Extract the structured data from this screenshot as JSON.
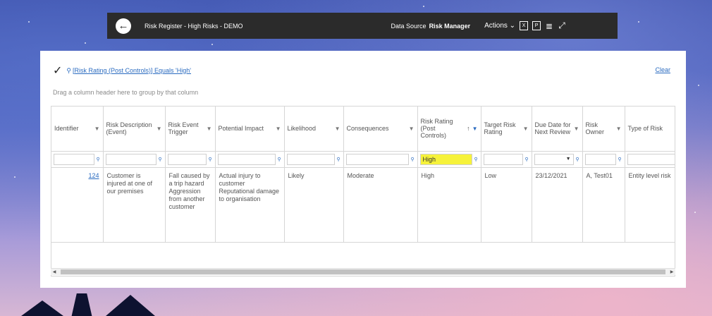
{
  "topbar": {
    "title": "Risk Register - High Risks - DEMO",
    "data_source_label": "Data Source",
    "data_source_value": "Risk Manager",
    "actions_label": "Actions ⌄",
    "icons": [
      "back-icon",
      "excel-export-icon",
      "pdf-export-icon",
      "list-icon",
      "expand-icon"
    ]
  },
  "filter": {
    "checkmark": "✓",
    "filter_icon": "⚲",
    "expression": "[Risk Rating (Post Controls)] Equals 'High'",
    "clear_label": "Clear"
  },
  "group_hint": "Drag a column header here to group by that column",
  "table": {
    "columns": [
      {
        "label": "Identifier"
      },
      {
        "label": "Risk Description (Event)"
      },
      {
        "label": "Risk Event Trigger"
      },
      {
        "label": "Potential Impact"
      },
      {
        "label": "Likelihood"
      },
      {
        "label": "Consequences"
      },
      {
        "label": "Risk Rating (Post Controls)"
      },
      {
        "label": "Target Risk Rating"
      },
      {
        "label": "Due Date for Next Review"
      },
      {
        "label": "Risk Owner"
      },
      {
        "label": "Type of Risk"
      }
    ],
    "filters": [
      "",
      "",
      "",
      "",
      "",
      "",
      "High",
      "",
      "",
      "",
      ""
    ],
    "rows": [
      {
        "identifier": "124",
        "risk_description": "Customer is injured at one of our premises",
        "event_trigger": "Fall caused by a trip hazard Aggression from another customer",
        "potential_impact": "Actual injury to customer Reputational damage to organisation",
        "likelihood": "Likely",
        "consequences": "Moderate",
        "risk_rating": "High",
        "target_risk_rating": "Low",
        "due_date": "23/12/2021",
        "risk_owner": "A, Test01",
        "type_of_risk": "Entity level risk"
      }
    ]
  },
  "colors": {
    "topbar_bg": "#2b2b2b",
    "link": "#2a6bc0",
    "highlight": "#f6f23a"
  }
}
